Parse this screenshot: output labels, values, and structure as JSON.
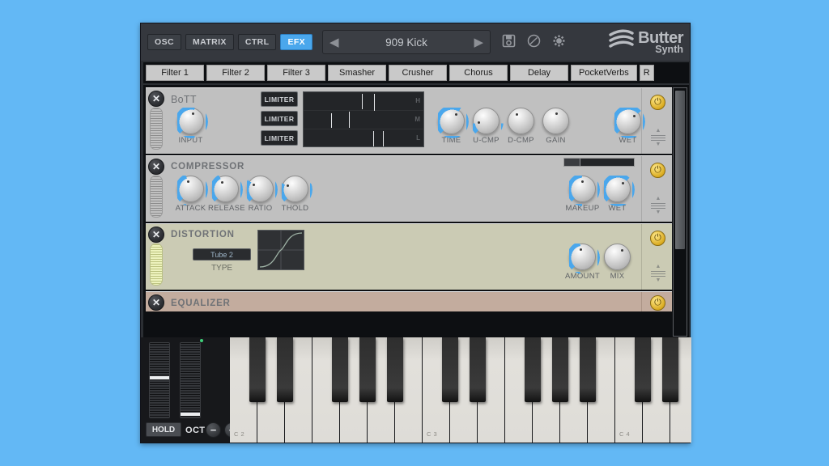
{
  "header": {
    "modes": [
      {
        "label": "OSC",
        "active": false
      },
      {
        "label": "MATRIX",
        "active": false
      },
      {
        "label": "CTRL",
        "active": false
      },
      {
        "label": "EFX",
        "active": true
      }
    ],
    "preset_name": "909 Kick",
    "prev_arrow": "◀",
    "next_arrow": "▶",
    "icons": [
      "save-icon",
      "knob-icon",
      "gear-icon"
    ],
    "logo_line1": "Butter",
    "logo_line2": "Synth",
    "accent_color": "#4aa7ec"
  },
  "tabs": [
    {
      "label": "Filter 1"
    },
    {
      "label": "Filter 2"
    },
    {
      "label": "Filter 3"
    },
    {
      "label": "Smasher"
    },
    {
      "label": "Crusher"
    },
    {
      "label": "Chorus"
    },
    {
      "label": "Delay"
    },
    {
      "label": "PocketVerbs"
    },
    {
      "label": "R"
    }
  ],
  "modules": [
    {
      "id": "bott",
      "title": "BoTT",
      "close_label": "✕",
      "power_label": "⏻",
      "meter_lit": false,
      "knobs_left": [
        {
          "label": "INPUT",
          "value": 55,
          "ringed": true
        }
      ],
      "limiters": [
        "LIMITER",
        "LIMITER",
        "LIMITER"
      ],
      "bands": [
        "H",
        "M",
        "L"
      ],
      "knobs_right": [
        {
          "label": "TIME",
          "value": 62,
          "ringed": true
        },
        {
          "label": "U-CMP",
          "value": 14,
          "ringed": true
        },
        {
          "label": "D-CMP",
          "value": 38,
          "ringed": false
        },
        {
          "label": "GAIN",
          "value": 50,
          "ringed": false
        },
        {
          "label": "WET",
          "value": 68,
          "ringed": true
        }
      ]
    },
    {
      "id": "compressor",
      "title": "COMPRESSOR",
      "close_label": "✕",
      "power_label": "⏻",
      "meter_lit": false,
      "knobs_left": [
        {
          "label": "ATTACK",
          "value": 42,
          "ringed": true
        },
        {
          "label": "RELEASE",
          "value": 40,
          "ringed": true
        },
        {
          "label": "RATIO",
          "value": 30,
          "ringed": true
        },
        {
          "label": "THOLD",
          "value": 26,
          "ringed": true
        }
      ],
      "knobs_right": [
        {
          "label": "MAKEUP",
          "value": 48,
          "ringed": true
        },
        {
          "label": "WET",
          "value": 66,
          "ringed": true
        }
      ]
    },
    {
      "id": "distortion",
      "title": "DISTORTION",
      "close_label": "✕",
      "power_label": "⏻",
      "meter_lit": true,
      "type_value": "Tube 2",
      "type_label": "TYPE",
      "knobs_right": [
        {
          "label": "AMOUNT",
          "value": 45,
          "ringed": true
        },
        {
          "label": "MIX",
          "value": 62,
          "ringed": false
        }
      ]
    },
    {
      "id": "equalizer",
      "title": "EQUALIZER",
      "close_label": "✕",
      "power_label": "⏻",
      "collapsed": true
    }
  ],
  "keyboard": {
    "hold_label": "HOLD",
    "oct_label": "OCT",
    "oct_minus": "−",
    "oct_plus": "+",
    "key_labels": [
      "C 2",
      "C 3",
      "C 4"
    ]
  }
}
